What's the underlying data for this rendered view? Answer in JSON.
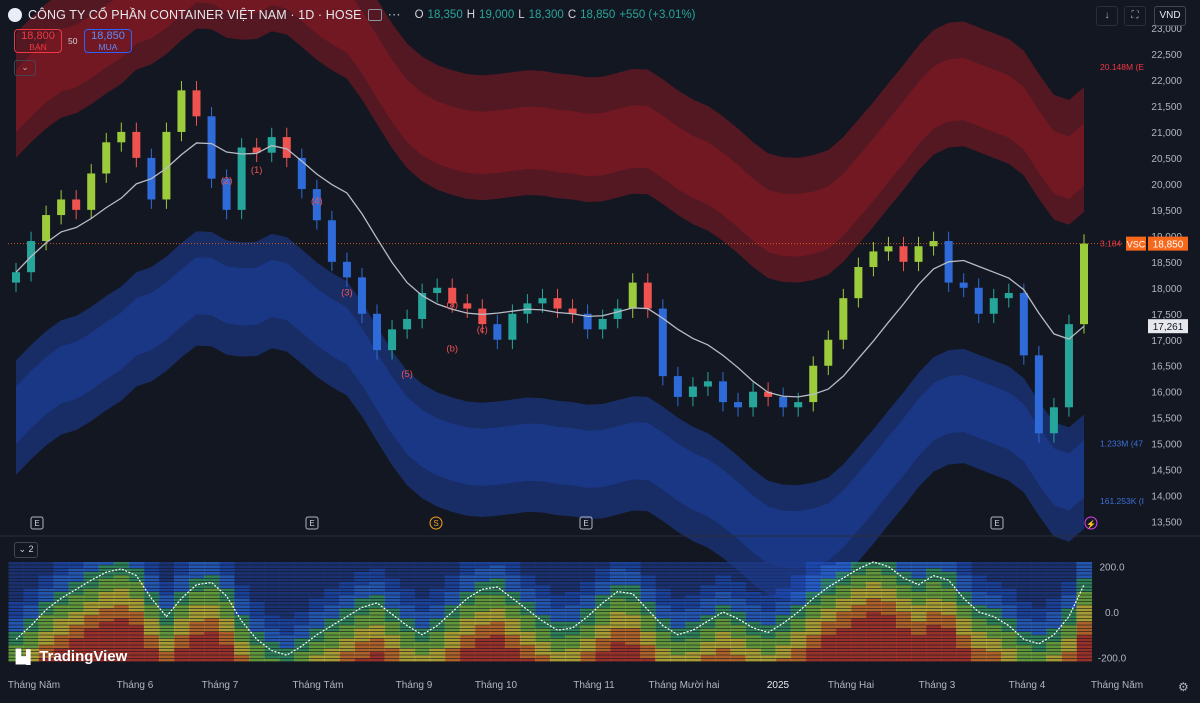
{
  "header": {
    "title": "CÔNG TY CỔ PHẦN CONTAINER VIỆT NAM · 1D · HOSE",
    "ohlc": [
      {
        "k": "O",
        "v": "18,350"
      },
      {
        "k": "H",
        "v": "19,000"
      },
      {
        "k": "L",
        "v": "18,300"
      },
      {
        "k": "C",
        "v": "18,850"
      },
      {
        "k": "",
        "v": "+550 (+3.01%)"
      }
    ],
    "currency": "VND"
  },
  "trade": {
    "sell_price": "18,800",
    "sell_label": "BÁN",
    "spread": "50",
    "buy_price": "18,850",
    "buy_label": "MUA"
  },
  "indicator_badge": "2",
  "branding": "TradingView",
  "colors": {
    "bg": "#131722",
    "up": "#26a69a",
    "down": "#ef5350",
    "price_tag": "#f7681b",
    "red_band": "#8b1a22",
    "blue_band": "#1d3f9e",
    "ma": "#b8bcc6",
    "candle_blue": "#2f6bd8"
  },
  "chart_data": {
    "type": "candlestick",
    "symbol": "VSC",
    "price_axis": {
      "ticks": [
        "23,000",
        "22,500",
        "22,000",
        "21,500",
        "21,000",
        "20,500",
        "20,000",
        "19,500",
        "19,000",
        "18,500",
        "18,000",
        "17,500",
        "17,000",
        "16,500",
        "16,000",
        "15,500",
        "15,000",
        "14,500",
        "14,000",
        "13,500"
      ],
      "ylim": [
        13300,
        23000
      ]
    },
    "time_axis": [
      "Tháng Năm",
      "Tháng 6",
      "Tháng 7",
      "Tháng Tám",
      "Tháng 9",
      "Tháng 10",
      "Tháng 11",
      "Tháng Mười hai",
      "2025",
      "Tháng Hai",
      "Tháng 3",
      "Tháng 4",
      "Tháng Năm"
    ],
    "last_price": {
      "symbol": "VSC",
      "value": 18850,
      "label": "18,850"
    },
    "ma_value": {
      "value": 17261,
      "label": "17,261"
    },
    "close_series": [
      18300,
      18900,
      19400,
      19700,
      19500,
      20200,
      20800,
      21000,
      20500,
      19700,
      21000,
      21800,
      21300,
      20100,
      19500,
      20700,
      20600,
      20900,
      20500,
      19900,
      19300,
      18500,
      18200,
      17500,
      16800,
      17200,
      17400,
      17900,
      18000,
      17700,
      17600,
      17300,
      17000,
      17500,
      17700,
      17800,
      17600,
      17500,
      17200,
      17400,
      17600,
      18100,
      17600,
      16300,
      15900,
      16100,
      16200,
      15800,
      15700,
      16000,
      15900,
      15700,
      15800,
      16500,
      17000,
      17800,
      18400,
      18700,
      18800,
      18500,
      18800,
      18900,
      18100,
      18000,
      17500,
      17800,
      17900,
      16700,
      15200,
      15700,
      17300,
      18850
    ],
    "series_labels": [
      {
        "name": "20.148M",
        "value": "20.148M (E"
      },
      {
        "name": "3.184",
        "value": "3.184"
      },
      {
        "name": "1.233M",
        "value": "1.233M (47"
      },
      {
        "name": "161.253K",
        "value": "161.253K (I"
      }
    ],
    "wave_labels": [
      "(2)",
      "(4)",
      "(a)",
      "(c)",
      "(5)",
      "(b)",
      "(3)",
      "(1)"
    ],
    "event_markers": [
      "E",
      "E",
      "S",
      "E",
      "E"
    ],
    "oscillator": {
      "ticks": [
        "200.0",
        "0.0",
        "-200.0"
      ],
      "ylim": [
        -220,
        220
      ],
      "values": [
        -120,
        -60,
        10,
        60,
        100,
        140,
        175,
        190,
        160,
        60,
        -20,
        60,
        120,
        130,
        70,
        -40,
        -120,
        -170,
        -190,
        -150,
        -100,
        -60,
        -20,
        20,
        40,
        -10,
        -60,
        -100,
        -60,
        0,
        60,
        100,
        110,
        60,
        10,
        -40,
        -80,
        -70,
        -20,
        40,
        90,
        80,
        10,
        -60,
        -100,
        -80,
        -40,
        0,
        -30,
        -70,
        -90,
        -50,
        0,
        60,
        110,
        150,
        190,
        220,
        200,
        150,
        120,
        160,
        140,
        60,
        0,
        -20,
        -60,
        -120,
        -140,
        -100,
        -20,
        120
      ]
    }
  }
}
